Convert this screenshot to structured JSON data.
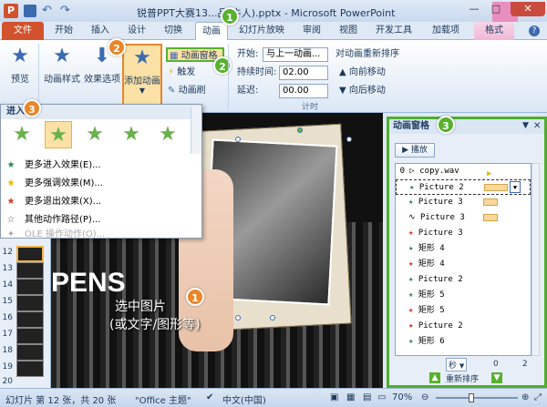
{
  "window": {
    "title": "锐普PPT大赛13...品(牛人).pptx - Microsoft PowerPoint",
    "quick_access": [
      "save-icon",
      "undo-icon",
      "redo-icon"
    ],
    "context_tab": "格式"
  },
  "tabs": [
    {
      "label": "文件"
    },
    {
      "label": "开始"
    },
    {
      "label": "插入"
    },
    {
      "label": "设计"
    },
    {
      "label": "切换"
    },
    {
      "label": "动画"
    },
    {
      "label": "幻灯片放映"
    },
    {
      "label": "审阅"
    },
    {
      "label": "视图"
    },
    {
      "label": "开发工具"
    },
    {
      "label": "加载项"
    },
    {
      "label": "格式"
    }
  ],
  "ribbon": {
    "preview": "预览",
    "animation_style": "动画样式",
    "effect_options": "效果选项",
    "add_animation": "添加动画",
    "animation_pane": "动画窗格",
    "trigger": "触发",
    "animation_painter": "动画刷",
    "start_label": "开始:",
    "start_value": "与上一动画...",
    "duration_label": "持续时间:",
    "duration_value": "02.00",
    "delay_label": "延迟:",
    "delay_value": "00.00",
    "timing_group": "计时",
    "reorder": "对动画重新排序",
    "move_earlier": "向前移动",
    "move_later": "向后移动"
  },
  "dropdown": {
    "header": "进入",
    "items": [
      {
        "label": "更多进入效果(E)...",
        "color": "#2e8b57"
      },
      {
        "label": "更多强调效果(M)...",
        "color": "#e6b800"
      },
      {
        "label": "更多退出效果(X)...",
        "color": "#d43a2a"
      },
      {
        "label": "其他动作路径(P)...",
        "color": "#555555"
      },
      {
        "label": "OLE 操作动作(O)...",
        "color": "#aaaaaa"
      }
    ]
  },
  "thumbs": [
    "12",
    "13",
    "14",
    "15",
    "16",
    "17",
    "18",
    "19",
    "20"
  ],
  "slide": {
    "pens_text": "PENS",
    "annotation_line1": "选中图片",
    "annotation_line2": "(或文字/图形等)"
  },
  "pane": {
    "title": "动画窗格",
    "play": "播放",
    "rows": [
      {
        "num": "0",
        "name": "copy.wav"
      },
      {
        "num": "",
        "name": "Picture 2"
      },
      {
        "num": "",
        "name": "Picture 3"
      },
      {
        "num": "",
        "name": "Picture 3"
      },
      {
        "num": "",
        "name": "Picture 3"
      },
      {
        "num": "",
        "name": "矩形 4"
      },
      {
        "num": "",
        "name": "矩形 4"
      },
      {
        "num": "",
        "name": "Picture 2"
      },
      {
        "num": "",
        "name": "矩形 5"
      },
      {
        "num": "",
        "name": "矩形 5"
      },
      {
        "num": "",
        "name": "Picture 2"
      },
      {
        "num": "",
        "name": "矩形 6"
      }
    ],
    "seconds_label": "秒",
    "timeline_start": "0",
    "timeline_end": "2",
    "reorder_label": "重新排序"
  },
  "status": {
    "slide_info": "幻灯片 第 12 张，共 20 张",
    "theme": "\"Office 主题\"",
    "language": "中文(中国)",
    "zoom": "70%"
  },
  "badges": {
    "b1": "1",
    "b2": "2",
    "b3": "3"
  }
}
